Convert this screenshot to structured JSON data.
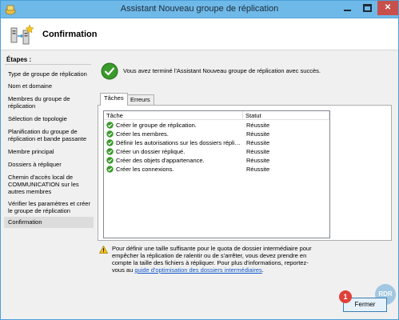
{
  "window": {
    "title": "Assistant Nouveau groupe de réplication"
  },
  "title_buttons": {
    "minimize_icon": "minimize-icon",
    "maximize_icon": "maximize-icon",
    "close_label": "✕"
  },
  "header": {
    "title": "Confirmation",
    "icon": "replication-wizard-icon"
  },
  "sidebar": {
    "title": "Étapes :",
    "steps": [
      {
        "label": "Type de groupe de réplication"
      },
      {
        "label": "Nom et domaine"
      },
      {
        "label": "Membres du groupe de réplication"
      },
      {
        "label": "Sélection de topologie"
      },
      {
        "label": "Planification du groupe de réplication et bande passante"
      },
      {
        "label": "Membre principal"
      },
      {
        "label": "Dossiers à répliquer"
      },
      {
        "label": "Chemin d'accès local de COMMUNICATION sur les autres membres"
      },
      {
        "label": "Vérifier les paramètres et créer le groupe de réplication"
      },
      {
        "label": "Confirmation",
        "active": true
      }
    ]
  },
  "main": {
    "success_message": "Vous avez terminé l'Assistant Nouveau groupe de réplication avec succès.",
    "tabs": [
      {
        "label": "Tâches"
      },
      {
        "label": "Erreurs"
      }
    ],
    "table": {
      "columns": [
        "Tâche",
        "Statut"
      ],
      "rows": [
        {
          "task": "Créer le groupe de réplication.",
          "status": "Réussite"
        },
        {
          "task": "Créer les membres.",
          "status": "Réussite"
        },
        {
          "task": "Définir les autorisations sur les dossiers répliqués.",
          "status": "Réussite"
        },
        {
          "task": "Créer un dossier répliqué.",
          "status": "Réussite"
        },
        {
          "task": "Créer des objets d'appartenance.",
          "status": "Réussite"
        },
        {
          "task": "Créer les connexions.",
          "status": "Réussite"
        }
      ]
    },
    "warning": {
      "text": "Pour définir une taille suffisante pour le quota de dossier intermédiaire pour empêcher la réplication de ralentir ou de s'arrêter, vous devez prendre en compte la taille des fichiers à répliquer. Pour plus d'informations, reportez-vous au ",
      "link": "guide d'optimisation des dossiers intermédiaires",
      "suffix": "."
    }
  },
  "footer": {
    "close_button": "Fermer",
    "badge": "1",
    "watermark": "RDR"
  },
  "colors": {
    "titlebar": "#6fb9e8",
    "success": "#3a9a2b",
    "link": "#1155cc",
    "badge": "#e0413a"
  }
}
